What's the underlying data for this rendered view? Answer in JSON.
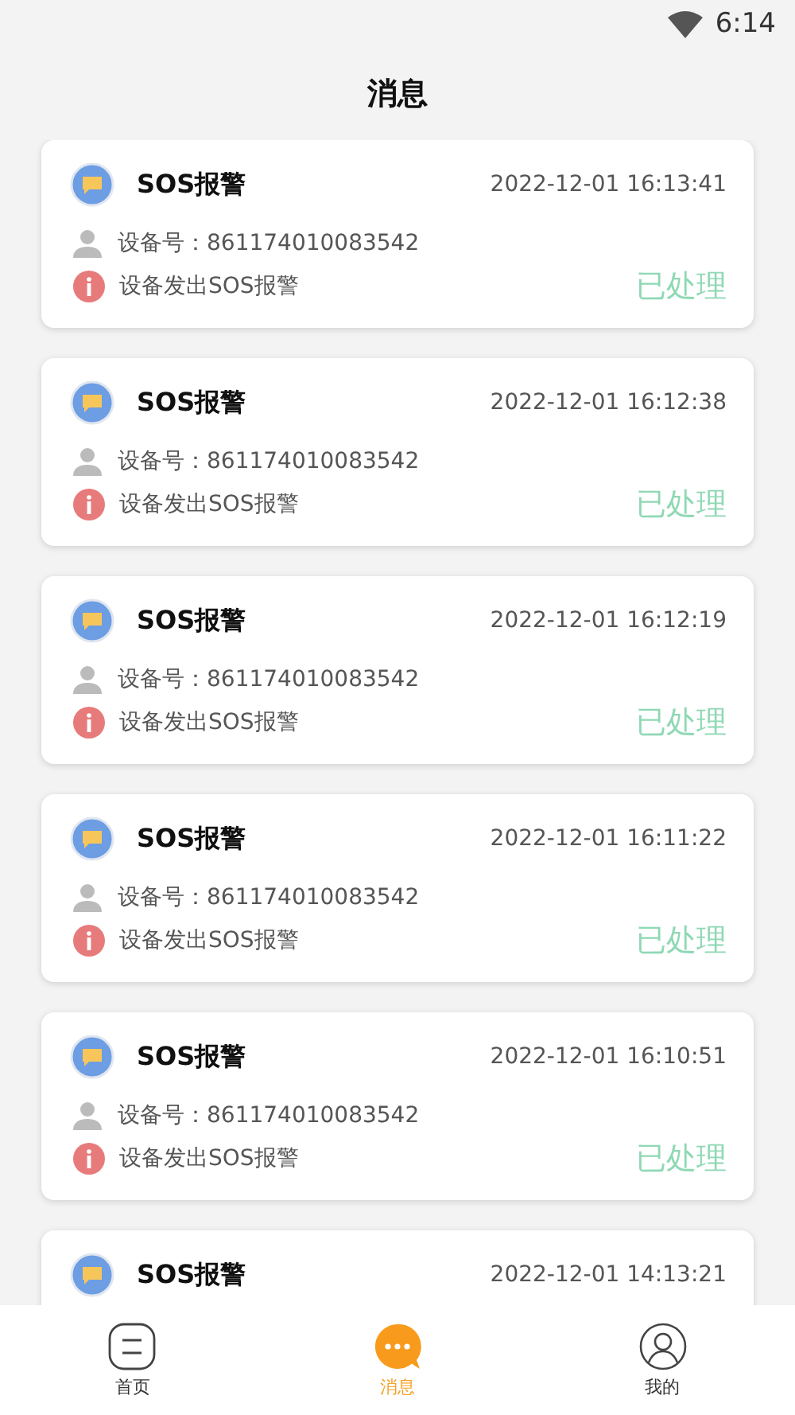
{
  "status_bar": {
    "time": "6:14"
  },
  "title": "消息",
  "messages": [
    {
      "title": "SOS报警",
      "time": "2022-12-01 16:13:41",
      "device": "设备号：861174010083542",
      "text": "设备发出SOS报警",
      "status": "已处理"
    },
    {
      "title": "SOS报警",
      "time": "2022-12-01 16:12:38",
      "device": "设备号：861174010083542",
      "text": "设备发出SOS报警",
      "status": "已处理"
    },
    {
      "title": "SOS报警",
      "time": "2022-12-01 16:12:19",
      "device": "设备号：861174010083542",
      "text": "设备发出SOS报警",
      "status": "已处理"
    },
    {
      "title": "SOS报警",
      "time": "2022-12-01 16:11:22",
      "device": "设备号：861174010083542",
      "text": "设备发出SOS报警",
      "status": "已处理"
    },
    {
      "title": "SOS报警",
      "time": "2022-12-01 16:10:51",
      "device": "设备号：861174010083542",
      "text": "设备发出SOS报警",
      "status": "已处理"
    },
    {
      "title": "SOS报警",
      "time": "2022-12-01 14:13:21"
    }
  ],
  "tabs": [
    {
      "kind": "home",
      "label": "首页",
      "selected": false
    },
    {
      "kind": "messages",
      "label": "消息",
      "selected": true
    },
    {
      "kind": "profile",
      "label": "我的",
      "selected": false
    }
  ]
}
